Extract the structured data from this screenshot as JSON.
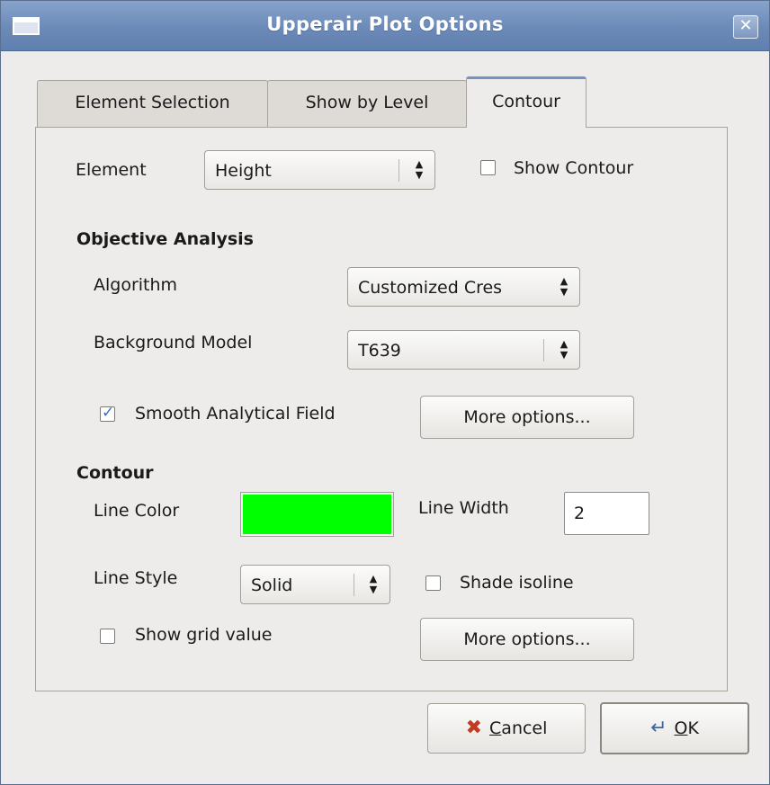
{
  "window": {
    "title": "Upperair Plot Options",
    "close_icon": "✕"
  },
  "tabs": [
    {
      "label": "Element Selection"
    },
    {
      "label": "Show by Level"
    },
    {
      "label": "Contour",
      "active": true
    }
  ],
  "element_row": {
    "label": "Element",
    "select_value": "Height",
    "show_contour_label": "Show Contour",
    "show_contour_checked": false
  },
  "objective_analysis": {
    "heading": "Objective Analysis",
    "algorithm_label": "Algorithm",
    "algorithm_value": "Customized Cres",
    "background_model_label": "Background Model",
    "background_model_value": "T639",
    "smooth_label": "Smooth Analytical Field",
    "smooth_checked": true,
    "more_options_label": "More options..."
  },
  "contour": {
    "heading": "Contour",
    "line_color_label": "Line Color",
    "line_color": "#00ff00",
    "line_width_label": "Line Width",
    "line_width_value": "2",
    "line_style_label": "Line Style",
    "line_style_value": "Solid",
    "shade_isoline_label": "Shade isoline",
    "shade_isoline_checked": false,
    "show_grid_value_label": "Show grid value",
    "show_grid_value_checked": false,
    "more_options_label": "More options..."
  },
  "buttons": {
    "cancel_first": "C",
    "cancel_rest": "ancel",
    "cancel_icon": "✖",
    "ok_first": "O",
    "ok_rest": "K",
    "ok_icon": "↵"
  },
  "colors": {
    "titlebar": "#6c8ab8",
    "dialog_bg": "#edeceb",
    "check_accent": "#3b6fc2"
  }
}
